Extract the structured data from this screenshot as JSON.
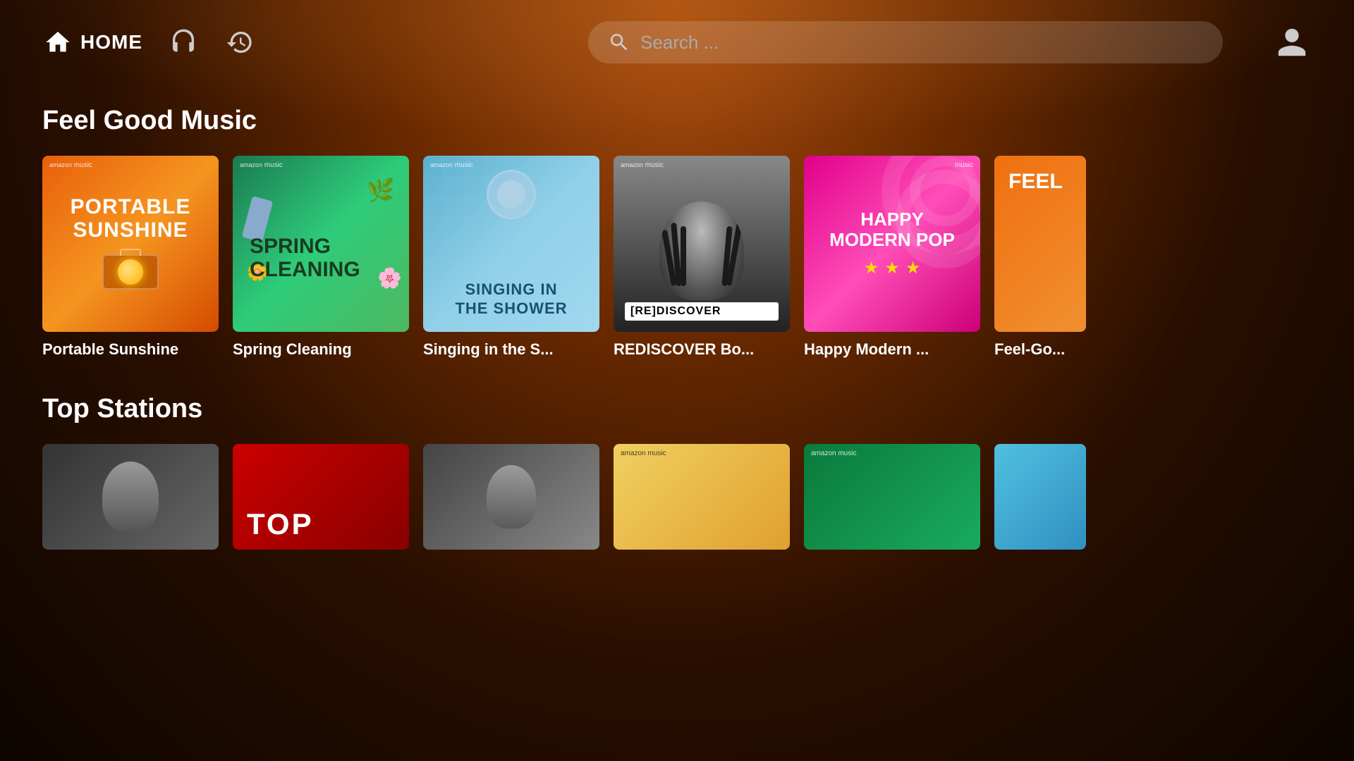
{
  "app": {
    "title": "Amazon Music"
  },
  "header": {
    "nav": {
      "home_label": "HOME",
      "home_icon": "house",
      "headphones_icon": "headphones",
      "history_icon": "history"
    },
    "search": {
      "placeholder": "Search ..."
    },
    "profile_icon": "user"
  },
  "sections": [
    {
      "id": "feel-good-music",
      "title": "Feel Good Music",
      "cards": [
        {
          "id": "portable-sunshine",
          "label": "Portable Sunshine",
          "line1": "PORTABLE",
          "line2": "SUNSHINE",
          "badge": "amazon music",
          "color_theme": "orange-warm"
        },
        {
          "id": "spring-cleaning",
          "label": "Spring Cleaning",
          "line1": "SPRING",
          "line2": "CLEANING",
          "badge": "amazon music",
          "color_theme": "green-mint"
        },
        {
          "id": "singing-shower",
          "label": "Singing in the S...",
          "line1": "SINGING IN",
          "line2": "THE SHOWER",
          "badge": "amazon music",
          "color_theme": "blue-light"
        },
        {
          "id": "rediscover",
          "label": "REDISCOVER Bo...",
          "badge_label": "[RE]DISCOVER",
          "badge": "amazon music",
          "color_theme": "dark-bw"
        },
        {
          "id": "happy-modern-pop",
          "label": "Happy Modern ...",
          "line1": "HAPPY",
          "line2": "MODERN POP",
          "stars": [
            "★",
            "★",
            "★"
          ],
          "badge": "music",
          "color_theme": "pink-magenta"
        },
        {
          "id": "feel-good-country",
          "label": "Feel-Go...",
          "line1": "FEEL",
          "color_theme": "orange-country"
        }
      ]
    },
    {
      "id": "top-stations",
      "title": "Top Stations",
      "cards": [
        {
          "id": "station-1",
          "color_theme": "dark-bw",
          "label": ""
        },
        {
          "id": "station-2",
          "color_theme": "red",
          "label": "ToP"
        },
        {
          "id": "station-3",
          "color_theme": "grey",
          "label": ""
        },
        {
          "id": "station-4",
          "color_theme": "yellow",
          "badge": "amazon music",
          "label": ""
        },
        {
          "id": "station-5",
          "color_theme": "green",
          "badge": "amazon music",
          "label": ""
        },
        {
          "id": "station-6",
          "color_theme": "blue",
          "label": ""
        }
      ]
    }
  ]
}
